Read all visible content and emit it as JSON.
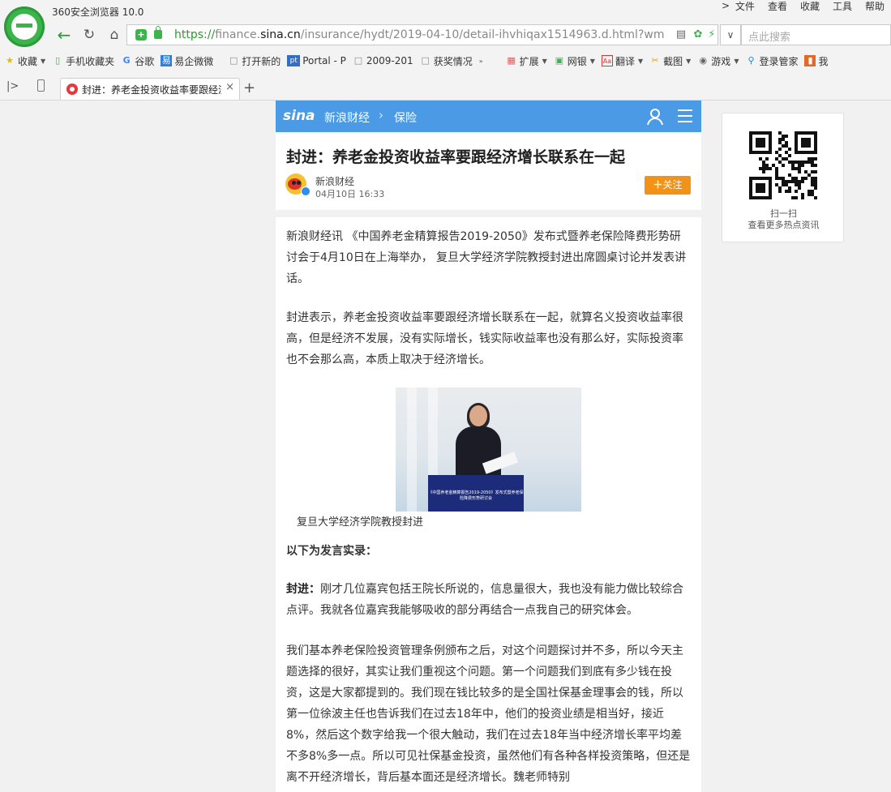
{
  "browser": {
    "app_title": "360安全浏览器 10.0",
    "menu": [
      "文件",
      "查看",
      "收藏",
      "工具",
      "帮助"
    ],
    "url": {
      "scheme": "https://",
      "sub": "finance.",
      "host": "sina.cn",
      "path": "/insurance/hydt/2019-04-10/detail-ihvhiqax1514963.d.html?wm"
    },
    "search_placeholder": "点此搜索",
    "bookmarks": [
      "收藏",
      "手机收藏夹",
      "谷歌",
      "易企微微",
      "打开新的",
      "Portal - P",
      "2009-201",
      "获奖情况"
    ],
    "extensions": [
      "扩展",
      "网银",
      "翻译",
      "截图",
      "游戏",
      "登录管家",
      "我"
    ],
    "tab_title": "封进：养老金投资收益率要跟经济增长联系在一起"
  },
  "page": {
    "breadcrumb": [
      "新浪财经",
      "保险"
    ],
    "logo_text": "sina",
    "headline": "封进：养老金投资收益率要跟经济增长联系在一起",
    "source": "新浪财经",
    "publish_time": "04月10日   16:33",
    "follow_label": "关注",
    "paragraphs": [
      "新浪财经讯 《中国养老金精算报告2019-2050》发布式暨养老保险降费形势研讨会于4月10日在上海举办， 复旦大学经济学院教授封进出席圆桌讨论并发表讲话。",
      "封进表示，养老金投资收益率要跟经济增长联系在一起，就算名义投资收益率很高，但是经济不发展，没有实际增长，钱实际收益率也没有那么好，实际投资率也不会那么高，本质上取决于经济增长。"
    ],
    "photo_banner": "《中国养老金精算报告2019-2050》发布式暨养老保险降费形势研讨会",
    "photo_caption": "复旦大学经济学院教授封进",
    "transcript_heading": "以下为发言实录：",
    "speaker": "封进：",
    "speech_1": "刚才几位嘉宾包括王院长所说的，信息量很大，我也没有能力做比较综合点评。我就各位嘉宾我能够吸收的部分再结合一点我自己的研究体会。",
    "speech_2": "我们基本养老保险投资管理条例颁布之后，对这个问题探讨并不多，所以今天主题选择的很好，其实让我们重视这个问题。第一个问题我们到底有多少钱在投资，这是大家都提到的。我们现在钱比较多的是全国社保基金理事会的钱，所以第一位徐波主任也告诉我们在过去18年中，他们的投资业绩是相当好，接近8%，然后这个数字给我一个很大触动，我们在过去18年当中经济增长率平均差不多8%多一点。所以可见社保基金投资，虽然他们有各种各样投资策略，但还是离不开经济增长，背后基本面还是经济增长。魏老师特别"
  },
  "sidebar": {
    "qr_line1": "扫一扫",
    "qr_line2": "查看更多热点资讯"
  },
  "colors": {
    "sina_blue": "#4a9ae6",
    "follow_orange": "#f29318",
    "browser_green": "#3bb54a"
  }
}
